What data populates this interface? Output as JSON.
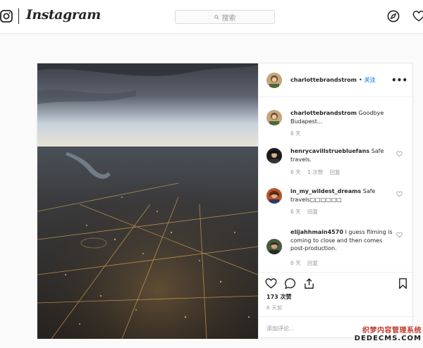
{
  "nav": {
    "logo_icon": "instagram-camera-icon",
    "wordmark": "Instagram",
    "search_placeholder": "搜索",
    "icons": [
      "search-icon",
      "explore-compass-icon",
      "activity-heart-icon"
    ]
  },
  "post": {
    "author": "charlottebrandstrom",
    "dot": "•",
    "follow_label": "关注",
    "more_icon": "more-options-icon",
    "more_label": "•••",
    "comments": [
      {
        "user": "charlottebrandstrom",
        "text": "Goodbye Budapest...",
        "time": "6 天",
        "likes": "",
        "reply": ""
      },
      {
        "user": "henrycavillstruebluefans",
        "text": "Safe travels.",
        "time": "6 天",
        "likes": "1 次赞",
        "reply": "回复"
      },
      {
        "user": "in_my_wildest_dreams",
        "text": "Safe travels□□□□□□",
        "time": "6 天",
        "likes": "",
        "reply": "回复"
      },
      {
        "user": "elijahhmain4570",
        "text": "I guess filming is coming to close and then comes post-production.",
        "time": "6 天",
        "likes": "",
        "reply": "回复"
      }
    ],
    "actions": [
      "like-heart-icon",
      "comment-bubble-icon",
      "share-icon",
      "save-bookmark-icon"
    ],
    "likes": "173 次赞",
    "when": "6 天前",
    "add_comment_placeholder": "添加评论..."
  },
  "watermark": {
    "line1": "织梦内容管理系统",
    "line2": "DEDECMS.COM"
  },
  "colors": {
    "accent": "#3897f0",
    "text": "#262626",
    "muted": "#999999",
    "border": "#efefef"
  }
}
